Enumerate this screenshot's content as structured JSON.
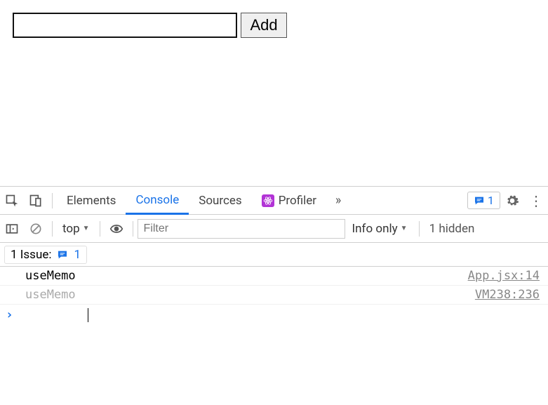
{
  "app": {
    "input_value": "",
    "add_label": "Add"
  },
  "devtools": {
    "tabs": {
      "elements": "Elements",
      "console": "Console",
      "sources": "Sources",
      "profiler": "Profiler"
    },
    "issues_count": "1",
    "console_toolbar": {
      "context": "top",
      "filter_placeholder": "Filter",
      "level": "Info only",
      "hidden": "1 hidden"
    },
    "issue_bar": {
      "label": "1 Issue:",
      "count": "1"
    },
    "logs": [
      {
        "msg": "useMemo",
        "src": "App.jsx:14",
        "dim": false
      },
      {
        "msg": "useMemo",
        "src": "VM238:236",
        "dim": true
      }
    ]
  }
}
